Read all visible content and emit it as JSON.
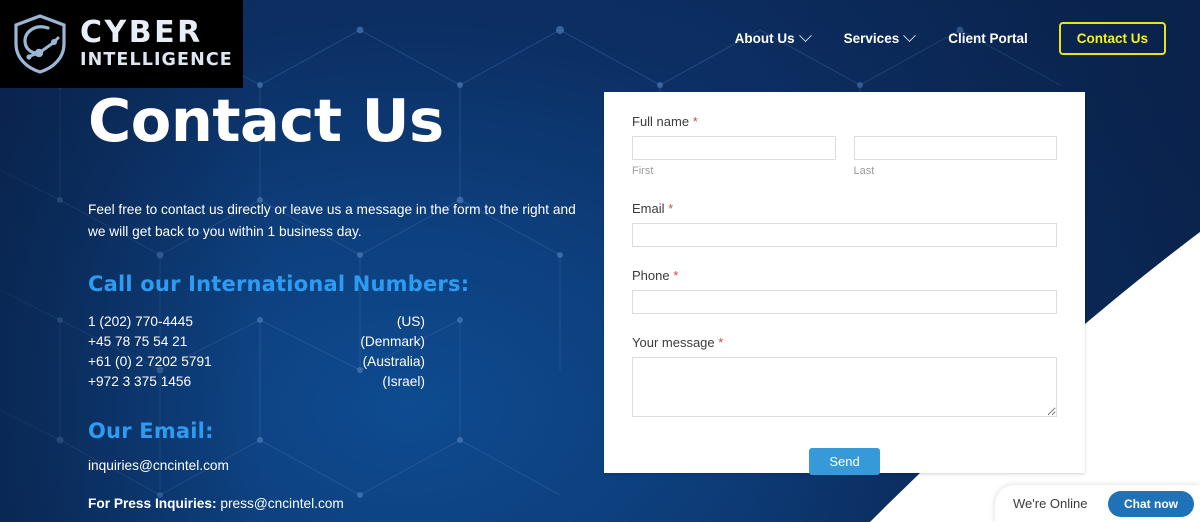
{
  "brand": {
    "logo_line1": "CYBER",
    "logo_line2": "INTELLIGENCE",
    "logo_icon": "shield-circuit-icon"
  },
  "nav": {
    "items": [
      {
        "label": "About Us",
        "has_dropdown": true
      },
      {
        "label": "Services",
        "has_dropdown": true
      },
      {
        "label": "Client Portal",
        "has_dropdown": false
      }
    ],
    "cta_label": "Contact Us",
    "cta_color": "#f6f21a"
  },
  "hero": {
    "title": "Contact Us",
    "intro": "Feel free to contact us directly or leave us a message in the form to the right and we will get back to you within 1 business day."
  },
  "phones": {
    "heading": "Call our International Numbers:",
    "heading_color": "#2e9bf0",
    "rows": [
      {
        "number": "1 (202) 770-4445",
        "country": "(US)"
      },
      {
        "number": "+45 78 75 54 21",
        "country": "(Denmark)"
      },
      {
        "number": "+61 (0) 2 7202 5791",
        "country": "(Australia)"
      },
      {
        "number": "+972 3 375 1456",
        "country": "(Israel)"
      }
    ]
  },
  "email": {
    "heading": "Our Email:",
    "primary": "inquiries@cncintel.com",
    "press_label": "For Press Inquiries:",
    "press_address": "press@cncintel.com"
  },
  "form": {
    "full_name": {
      "label": "Full name",
      "required_mark": "*",
      "first": {
        "value": "",
        "placeholder": "",
        "sub_label": "First"
      },
      "last": {
        "value": "",
        "placeholder": "",
        "sub_label": "Last"
      }
    },
    "email": {
      "label": "Email",
      "required_mark": "*",
      "value": "",
      "placeholder": ""
    },
    "phone": {
      "label": "Phone",
      "required_mark": "*",
      "value": "",
      "placeholder": ""
    },
    "message": {
      "label": "Your message",
      "required_mark": "*",
      "value": "",
      "placeholder": ""
    },
    "submit_label": "Send",
    "submit_color": "#3699d8"
  },
  "chat": {
    "status_text": "We're Online",
    "button_label": "Chat now",
    "button_color": "#1f72b8"
  },
  "theme": {
    "background_navy": "#0d2a5c",
    "background_blue": "#0e4b90",
    "accent_blue": "#2e9bf0",
    "accent_yellow": "#f6f21a",
    "card_background": "#ffffff"
  }
}
